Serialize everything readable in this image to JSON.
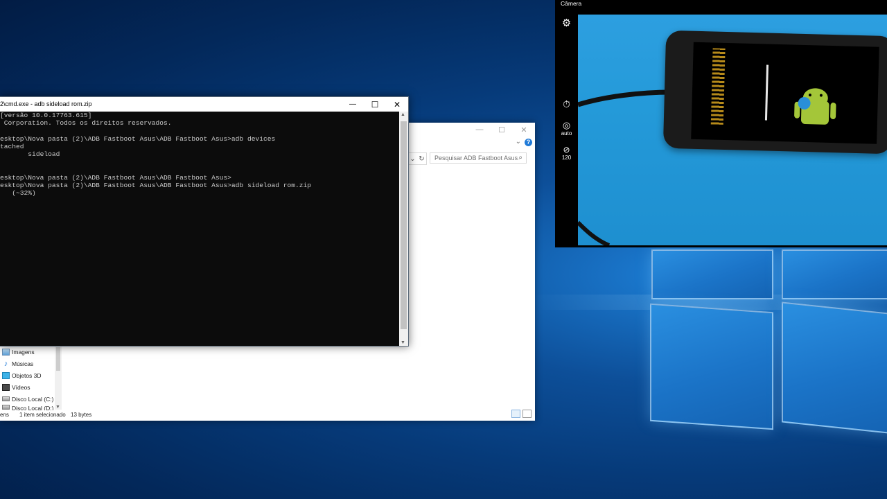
{
  "cmd": {
    "title": "2\\cmd.exe - adb  sideload rom.zip",
    "controls": {
      "minimize": "—",
      "maximize": "☐",
      "close": "✕"
    },
    "lines": [
      "[versão 10.0.17763.615]",
      " Corporation. Todos os direitos reservados.",
      "",
      "esktop\\Nova pasta (2)\\ADB Fastboot Asus\\ADB Fastboot Asus>adb devices",
      "tached",
      "       sideload",
      "",
      "",
      "esktop\\Nova pasta (2)\\ADB Fastboot Asus\\ADB Fastboot Asus>",
      "esktop\\Nova pasta (2)\\ADB Fastboot Asus\\ADB Fastboot Asus>adb sideload rom.zip",
      "   (~32%)"
    ]
  },
  "explorer": {
    "controls": {
      "minimize": "—",
      "maximize": "☐",
      "close": "✕"
    },
    "search_placeholder": "Pesquisar ADB Fastboot Asus",
    "nav_items": [
      {
        "label": "Imagens",
        "icon": "pictures-icon"
      },
      {
        "label": "Músicas",
        "icon": "music-icon"
      },
      {
        "label": "Objetos 3D",
        "icon": "objects-3d-icon"
      },
      {
        "label": "Vídeos",
        "icon": "videos-icon"
      },
      {
        "label": "Disco Local (C:)",
        "icon": "drive-icon"
      },
      {
        "label": "Disco Local (D:)",
        "icon": "drive-icon"
      }
    ],
    "status": {
      "items": "ens",
      "selected": "1 item selecionado",
      "size": "13 bytes"
    }
  },
  "camera": {
    "title": "Câmera",
    "settings_icon": "gear-icon",
    "timer_icon": "timer-icon",
    "brightness_label": "auto",
    "fps_label": "120"
  },
  "colors": {
    "cmd_bg": "#0c0c0c",
    "cmd_text": "#cccccc",
    "accent": "#1f7ad8",
    "desktop": "#063a79"
  }
}
